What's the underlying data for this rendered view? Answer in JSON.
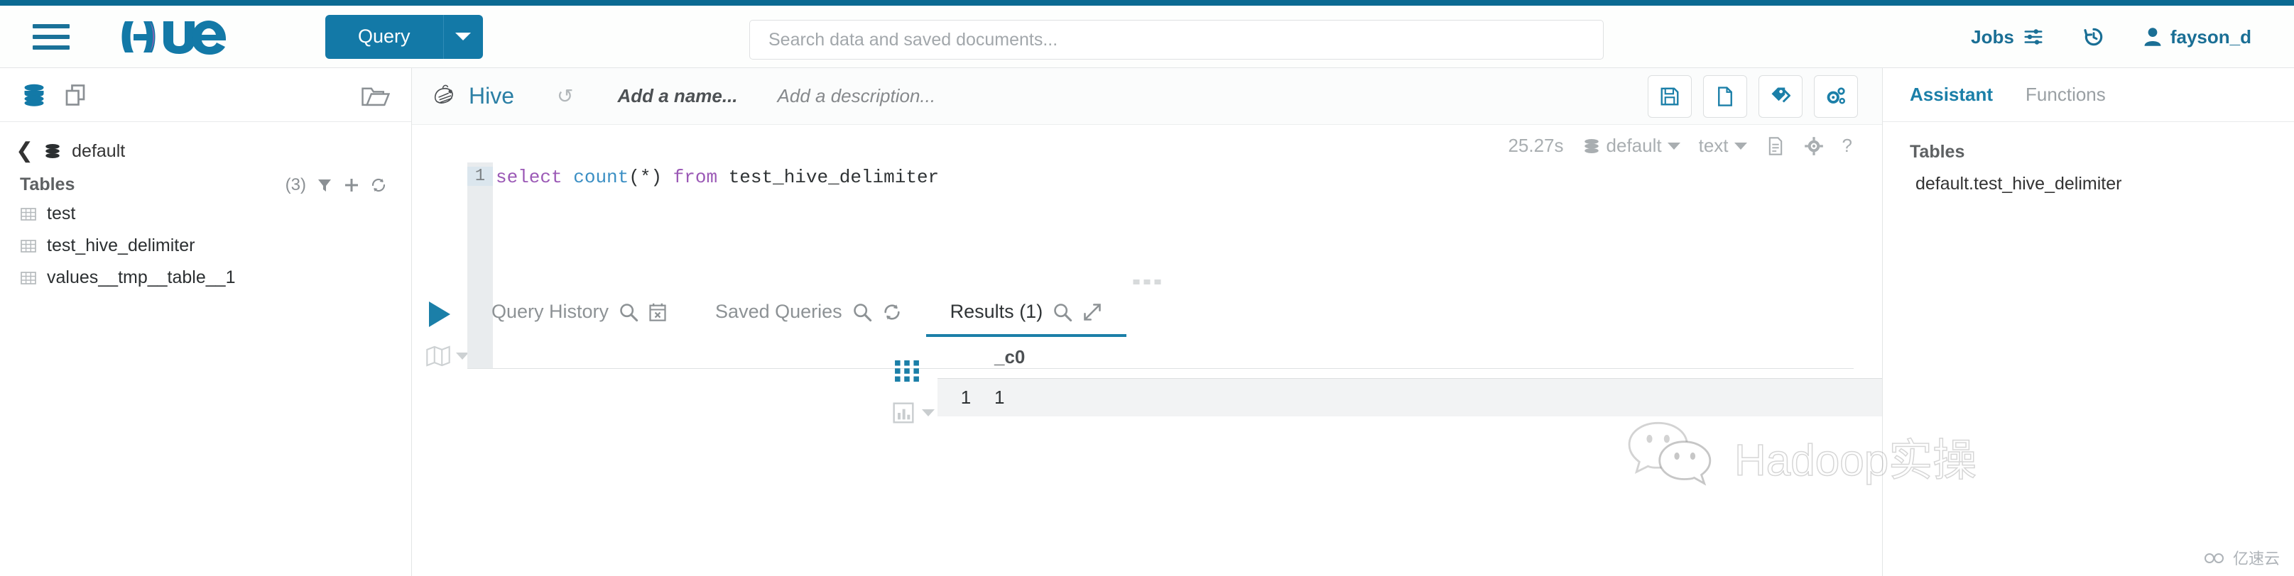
{
  "brand": {
    "name": "Hue",
    "logo_icon": "hue-logo"
  },
  "navbar": {
    "menu_icon": "hamburger-icon",
    "query_button": "Query",
    "query_caret_icon": "chevron-down-icon",
    "search": {
      "placeholder": "Search data and saved documents...",
      "value": "",
      "icon": "search-input"
    },
    "jobs_label": "Jobs",
    "jobs_icon": "sliders-icon",
    "history_icon": "history-icon",
    "user_icon": "user-icon",
    "username": "fayson_d"
  },
  "left_panel": {
    "head_icons": [
      "database-icon",
      "documents-icon",
      "open-folder-icon"
    ],
    "breadcrumb": {
      "back_icon": "chevron-left-icon",
      "db_icon": "database-icon",
      "db_name": "default"
    },
    "tables_header": {
      "title": "Tables",
      "count": "(3)",
      "filter_icon": "filter-icon",
      "add_icon": "plus-icon",
      "refresh_icon": "refresh-icon"
    },
    "tables": [
      {
        "icon": "table-icon",
        "name": "test"
      },
      {
        "icon": "table-icon",
        "name": "test_hive_delimiter"
      },
      {
        "icon": "table-icon",
        "name": "values__tmp__table__1"
      }
    ]
  },
  "editor": {
    "engine_icon": "hive-bee-icon",
    "engine_name": "Hive",
    "undo_icon": "history-icon",
    "name_placeholder": "Add a name...",
    "description_placeholder": "Add a description...",
    "toolbar_buttons": [
      {
        "icon": "save-icon",
        "name": "save-button"
      },
      {
        "icon": "new-document-icon",
        "name": "new-document-button"
      },
      {
        "icon": "tags-icon",
        "name": "tags-button"
      },
      {
        "icon": "settings-gears-icon",
        "name": "settings-button"
      }
    ],
    "meta": {
      "duration": "25.27s",
      "database_icon": "database-icon",
      "database": "default",
      "format": "text",
      "log_icon": "document-log-icon",
      "gear_icon": "gear-icon",
      "help_icon": "help-icon"
    },
    "run_button_icon": "play-icon",
    "explain_icon": "map-icon",
    "line_number": "1",
    "sql": {
      "tokens": [
        {
          "t": "select",
          "c": "kw"
        },
        {
          "t": " ",
          "c": "pl"
        },
        {
          "t": "count",
          "c": "fn"
        },
        {
          "t": "(*)",
          "c": "pl"
        },
        {
          "t": " ",
          "c": "pl"
        },
        {
          "t": "from",
          "c": "kw"
        },
        {
          "t": " test_hive_delimiter",
          "c": "pl"
        }
      ],
      "plain": "select count(*) from test_hive_delimiter"
    }
  },
  "result_tabs": [
    {
      "label": "Query History",
      "icons": [
        "search-icon",
        "calendar-x-icon"
      ],
      "active": false
    },
    {
      "label": "Saved Queries",
      "icons": [
        "search-icon",
        "refresh-icon"
      ],
      "active": false
    },
    {
      "label": "Results (1)",
      "icons": [
        "search-icon",
        "expand-icon"
      ],
      "active": true
    }
  ],
  "results": {
    "grid_icon": "grid-view-icon",
    "chart_icon": "chart-view-icon",
    "chart_caret_icon": "chevron-down-icon",
    "columns": [
      "_c0"
    ],
    "rows": [
      {
        "number": "1",
        "cells": [
          "1"
        ]
      }
    ]
  },
  "right_panel": {
    "tabs": [
      {
        "label": "Assistant",
        "active": true
      },
      {
        "label": "Functions",
        "active": false
      }
    ],
    "section_title": "Tables",
    "items": [
      "default.test_hive_delimiter"
    ]
  },
  "watermark": {
    "text": "Hadoop实操",
    "icon": "wechat-icon"
  },
  "corner_badge": {
    "text": "亿速云",
    "icon": "cloud-icon"
  },
  "colors": {
    "accent": "#1379a7",
    "top_bar": "#0b6a92",
    "link": "#1a6f95",
    "keyword": "#9b59b6",
    "function": "#3b8fc4",
    "muted": "#9aa0a4"
  }
}
